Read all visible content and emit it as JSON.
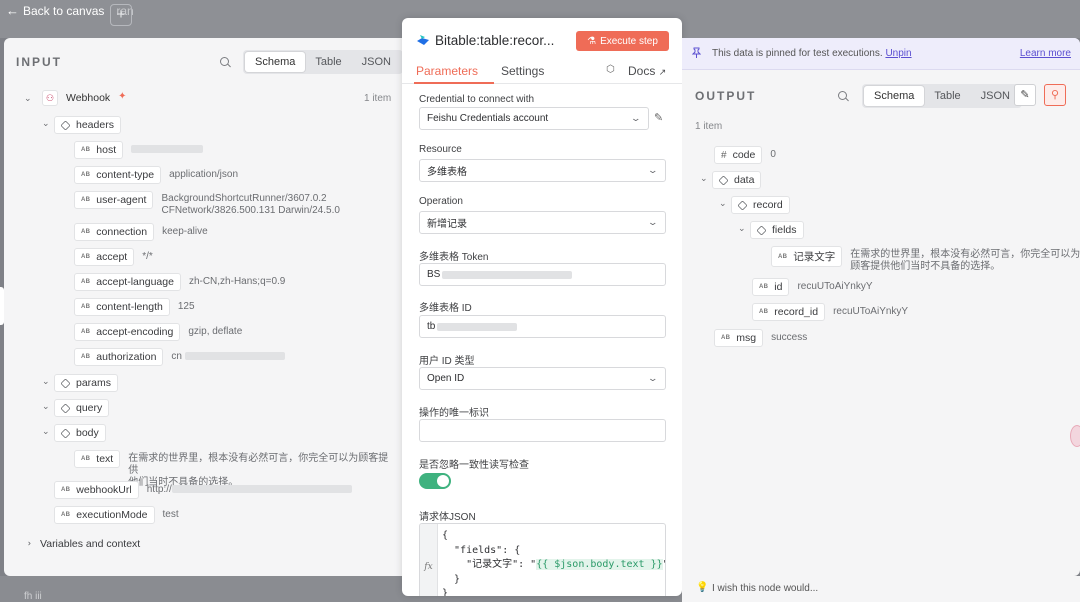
{
  "canvas": {
    "back_label": "Back to canvas",
    "canvas_title": "ran",
    "bottom_ghost": "fh iii"
  },
  "input": {
    "title": "INPUT",
    "tabs": [
      "Schema",
      "Table",
      "JSON"
    ],
    "active_tab": "Schema",
    "node_name": "Webhook",
    "item_count": "1 item",
    "fields": {
      "headers": "headers",
      "host": "host",
      "content_type": "content-type",
      "content_type_val": "application/json",
      "user_agent": "user-agent",
      "user_agent_val_1": "BackgroundShortcutRunner/3607.0.2",
      "user_agent_val_2": "CFNetwork/3826.500.131 Darwin/24.5.0",
      "connection": "connection",
      "connection_val": "keep-alive",
      "accept": "accept",
      "accept_val": "*/*",
      "accept_language": "accept-language",
      "accept_language_val": "zh-CN,zh-Hans;q=0.9",
      "content_length": "content-length",
      "content_length_val": "125",
      "accept_encoding": "accept-encoding",
      "accept_encoding_val": "gzip, deflate",
      "authorization": "authorization",
      "authorization_val": "cn",
      "params": "params",
      "query": "query",
      "body": "body",
      "text": "text",
      "text_val_1": "在需求的世界里，根本没有必然可言，你完全可以为顾客提供",
      "text_val_2": "他们当时不具备的选择。",
      "webhook_url": "webhookUrl",
      "webhook_url_val": "http://",
      "execution_mode": "executionMode",
      "execution_mode_val": "test",
      "variables": "Variables and context"
    }
  },
  "center": {
    "title": "Bitable:table:recor...",
    "execute_label": "Execute step",
    "tabs": {
      "parameters": "Parameters",
      "settings": "Settings",
      "docs": "Docs"
    },
    "credential_label": "Credential to connect with",
    "credential_value": "Feishu Credentials account",
    "resource_label": "Resource",
    "resource_value": "多维表格",
    "operation_label": "Operation",
    "operation_value": "新增记录",
    "token_label": "多维表格 Token",
    "token_value": "BS",
    "table_id_label": "多维表格 ID",
    "table_id_value": "tb",
    "user_id_type_label": "用户 ID 类型",
    "user_id_type_value": "Open ID",
    "unique_id_label": "操作的唯一标识",
    "unique_id_value": "",
    "ignore_consistency_label": "是否忽略一致性读写检查",
    "body_json_label": "请求体JSON",
    "code": {
      "line1": "{",
      "line2": "  \"fields\": {",
      "line3_prefix": "    \"记录文字\": \"",
      "line3_expr": "{{ $json.body.text }}",
      "line3_suffix": "\"",
      "line4": "  }",
      "line5": "}"
    }
  },
  "output": {
    "pin_text": "This data is pinned for test executions.",
    "unpin": "Unpin",
    "learn_more": "Learn more",
    "title": "OUTPUT",
    "tabs": [
      "Schema",
      "Table",
      "JSON"
    ],
    "active_tab": "Schema",
    "item_count": "1 item",
    "fields": {
      "code": "code",
      "code_val": "0",
      "data": "data",
      "record": "record",
      "fields": "fields",
      "record_text": "记录文字",
      "record_text_val_1": "在需求的世界里，根本没有必然可言，你完全可以为",
      "record_text_val_2": "顾客提供他们当时不具备的选择。",
      "id": "id",
      "id_val": "recuUToAiYnkyY",
      "record_id": "record_id",
      "record_id_val": "recuUToAiYnkyY",
      "msg": "msg",
      "msg_val": "success"
    },
    "wish": "I wish this node would..."
  },
  "colors": {
    "accent": "#ef6c57",
    "toggle_on": "#3fb27f",
    "link": "#5b4fd1"
  }
}
